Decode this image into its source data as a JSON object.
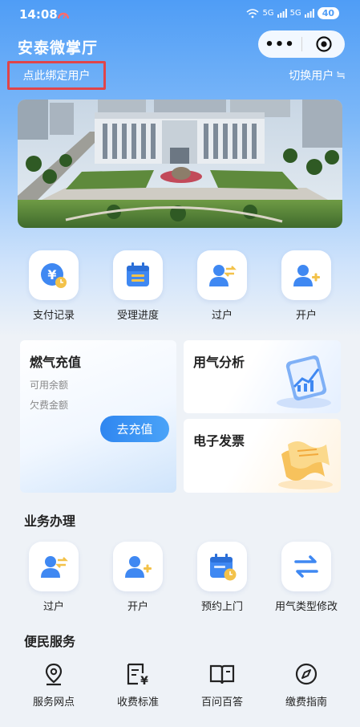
{
  "status_bar": {
    "time": "14:08",
    "network": "5G",
    "battery": "40"
  },
  "header": {
    "title": "安泰微掌厅",
    "more_icon": "more-dots-icon",
    "close_icon": "target-close-icon"
  },
  "account": {
    "bind_label": "点此绑定用户",
    "switch_label": "切换用户",
    "switch_icon": "≒"
  },
  "banner": {
    "image": "office-building-photo"
  },
  "quick_actions": [
    {
      "label": "支付记录",
      "icon": "payment-record-icon"
    },
    {
      "label": "受理进度",
      "icon": "progress-calendar-icon"
    },
    {
      "label": "过户",
      "icon": "transfer-user-icon"
    },
    {
      "label": "开户",
      "icon": "add-user-icon"
    }
  ],
  "cards": {
    "recharge": {
      "title": "燃气充值",
      "balance_label": "可用余额",
      "arrears_label": "欠费金额",
      "button_label": "去充值"
    },
    "analysis": {
      "title": "用气分析"
    },
    "invoice": {
      "title": "电子发票"
    }
  },
  "business": {
    "title": "业务办理",
    "items": [
      {
        "label": "过户",
        "icon": "transfer-user-icon"
      },
      {
        "label": "开户",
        "icon": "add-user-icon"
      },
      {
        "label": "预约上门",
        "icon": "appointment-calendar-icon"
      },
      {
        "label": "用气类型修改",
        "icon": "swap-arrows-icon"
      }
    ]
  },
  "services": {
    "title": "便民服务",
    "items": [
      {
        "label": "服务网点",
        "icon": "location-pin-icon"
      },
      {
        "label": "收费标准",
        "icon": "fee-document-icon"
      },
      {
        "label": "百问百答",
        "icon": "book-icon"
      },
      {
        "label": "缴费指南",
        "icon": "compass-icon"
      }
    ]
  },
  "colors": {
    "primary": "#2f86f0",
    "highlight_border": "#e0454a",
    "accent_orange": "#f5b43a"
  }
}
